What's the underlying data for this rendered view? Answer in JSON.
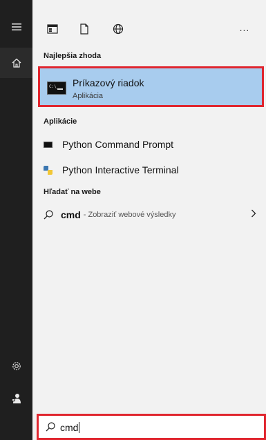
{
  "sections": {
    "best_match": "Najlepšia zhoda",
    "apps": "Aplikácie",
    "web": "Hľadať na webe"
  },
  "best_match": {
    "title": "Príkazový riadok",
    "subtitle": "Aplikácia",
    "icon": "command-prompt-icon"
  },
  "apps": [
    {
      "label": "Python Command Prompt",
      "icon": "terminal-icon"
    },
    {
      "label": "Python Interactive Terminal",
      "icon": "python-icon"
    }
  ],
  "web_result": {
    "query": "cmd",
    "dash": "-",
    "description": "Zobraziť webové výsledky"
  },
  "topbar": {
    "more": "..."
  },
  "search": {
    "value": "cmd"
  },
  "colors": {
    "highlight": "#a8ccee",
    "annotation_border": "#e0262f",
    "rail": "#1f1f1f"
  }
}
